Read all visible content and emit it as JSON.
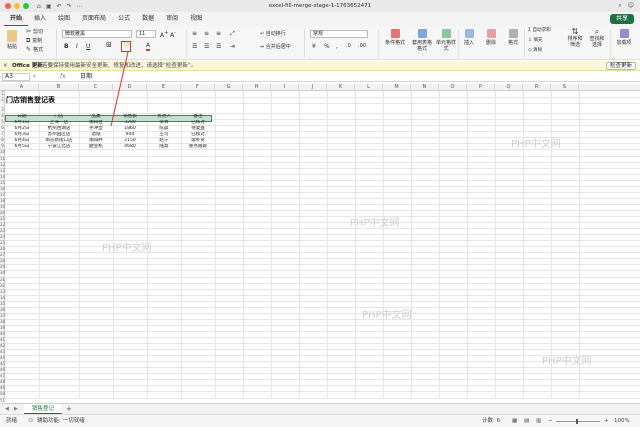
{
  "window": {
    "title": "excel-fill-merge-stage-1-1763652471"
  },
  "menu_tabs": [
    "开始",
    "插入",
    "绘图",
    "页面布局",
    "公式",
    "数据",
    "审阅",
    "视图"
  ],
  "share_label": "共享",
  "ribbon": {
    "paste": "粘贴",
    "cut": "剪切",
    "copy": "复制",
    "format_painter": "格式",
    "font_name": "微软雅黑",
    "font_size": "11",
    "wrap_text": "自动换行",
    "merge_center": "合并后居中",
    "number_format": "常规",
    "conditional_format": "条件格式",
    "format_as_table": "套用表格格式",
    "cell_styles": "单元格样式",
    "insert": "插入",
    "delete": "删除",
    "format": "格式",
    "autosum": "自动求和",
    "fill": "填充",
    "clear": "清除",
    "sort_filter": "排序和筛选",
    "find_select": "查找和选择",
    "addins": "加载项"
  },
  "notice": {
    "label": "Office 更新",
    "message": "若要保持使用最新安全更新、修复和改进，请选择“检查更新”。",
    "button": "检查更新"
  },
  "formula_bar": {
    "name_box": "A3",
    "fx": "fx",
    "value": "日期"
  },
  "columns": [
    "A",
    "B",
    "C",
    "D",
    "E",
    "F",
    "G",
    "H",
    "I",
    "J",
    "K",
    "L",
    "M",
    "N",
    "O",
    "P",
    "Q",
    "R",
    "S"
  ],
  "rows": [
    "1",
    "2",
    "3",
    "4",
    "5",
    "6",
    "7",
    "8",
    "9",
    "10",
    "11",
    "12",
    "13",
    "14",
    "15",
    "16",
    "17",
    "18",
    "19",
    "20",
    "21",
    "22",
    "23",
    "24",
    "25",
    "26",
    "27",
    "28",
    "29",
    "30",
    "31",
    "32",
    "33",
    "34",
    "35",
    "36",
    "37",
    "38",
    "39",
    "40",
    "41",
    "42",
    "43",
    "44",
    "45",
    "46",
    "47",
    "48",
    "49",
    "50",
    "51"
  ],
  "sheet": {
    "title": "门店销售登记表",
    "headers": [
      "日期",
      "门店",
      "品类",
      "销售额",
      "负责人",
      "备注"
    ],
    "data": [
      [
        "6月1日",
        "上海一店",
        "咖啡豆",
        "3200",
        "李青",
        "已核对"
      ],
      [
        "6月2日",
        "杭州西湖店",
        "手冲壶",
        "1860",
        "陈晨",
        "待复盘"
      ],
      [
        "6月3日",
        "苏州园区店",
        "滤纸",
        "940",
        "王可",
        "已核对"
      ],
      [
        "6月4日",
        "南京新街口店",
        "咖啡杯",
        "2150",
        "赵宁",
        "需补货"
      ],
      [
        "6月5日",
        "宁波江北店",
        "磨豆机",
        "4680",
        "陆高",
        "重点跟踪"
      ]
    ]
  },
  "watermark": "PHP中文网",
  "sheet_tabs": [
    "销售登记"
  ],
  "status": {
    "ready": "就绪",
    "accessibility": "辅助功能: 一切就绪",
    "count": "计数: 6",
    "zoom": "100%"
  },
  "colors": {
    "accent": "#1e7145",
    "header_fill": "#c5dfd0",
    "annotation": "#e0322f"
  }
}
